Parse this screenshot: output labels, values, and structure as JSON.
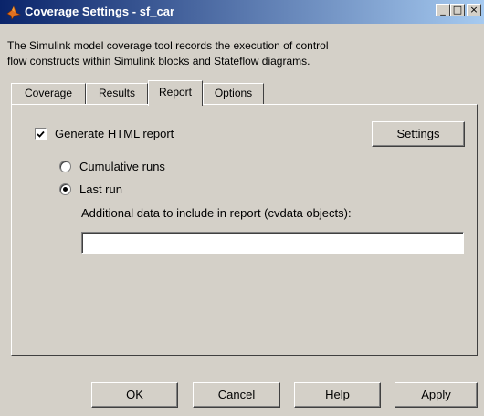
{
  "window": {
    "title": "Coverage Settings - sf_car",
    "minimize_glyph": "_",
    "maximize_glyph": "□",
    "close_glyph": "×"
  },
  "description": {
    "line1": "The Simulink model coverage tool records the execution of control",
    "line2": "flow constructs within Simulink blocks and Stateflow diagrams."
  },
  "tabs": [
    {
      "label": "Coverage",
      "active": false
    },
    {
      "label": "Results",
      "active": false
    },
    {
      "label": "Report",
      "active": true
    },
    {
      "label": "Options",
      "active": false
    }
  ],
  "report": {
    "generate_html": {
      "label": "Generate HTML report",
      "checked": true
    },
    "settings_button": "Settings",
    "radio_options": [
      {
        "label": "Cumulative runs",
        "selected": false
      },
      {
        "label": "Last run",
        "selected": true
      }
    ],
    "additional_data_label": "Additional data to include in report (cvdata objects):",
    "additional_data_value": ""
  },
  "buttons": {
    "ok": "OK",
    "cancel": "Cancel",
    "help": "Help",
    "apply": "Apply"
  },
  "colors": {
    "dialog_face": "#d4d0c8",
    "title_start": "#0a246a",
    "title_end": "#a6caf0"
  },
  "icons": {
    "app": "simulink-logo-icon",
    "check": "checkmark-icon",
    "radio_dot": "radio-dot-icon"
  }
}
